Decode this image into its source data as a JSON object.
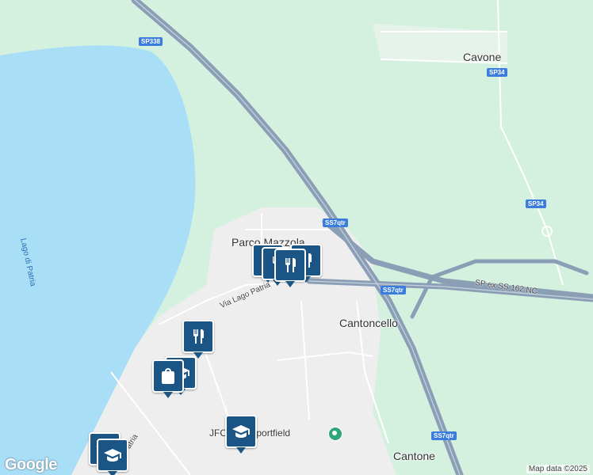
{
  "map": {
    "place_labels": {
      "cavone": "Cavone",
      "parco_mazzola": "Parco Mazzola",
      "cantoncello": "Cantoncello",
      "cantone": "Cantone"
    },
    "road_shields": {
      "sp338": "SP338",
      "sp34_north": "SP34",
      "sp34_east": "SP34",
      "ss7qtr_north": "SS7qtr",
      "ss7qtr_mid": "SS7qtr",
      "ss7qtr_south": "SS7qtr"
    },
    "road_labels": {
      "via_lago_patria": "Via Lago Patria",
      "sp_ex_ss162": "SP ex SS 162 NC",
      "lago_patria_bottom": "Lago Patria"
    },
    "lake_label": "Lago di Patria",
    "poi_labels": {
      "sportfield": "JFC      LES Sportfield"
    },
    "colors": {
      "water": "#a9def7",
      "land_green": "#d4f1e0",
      "urban": "#eeeeef",
      "highway": "#8a9fb5",
      "pin": "#1b5585",
      "sport": "#2fa779"
    },
    "pins": [
      {
        "type": "restaurant",
        "icon": "fork-knife-icon"
      },
      {
        "type": "restaurant",
        "icon": "fork-knife-icon"
      },
      {
        "type": "restaurant",
        "icon": "fork-knife-icon"
      },
      {
        "type": "restaurant",
        "icon": "fork-knife-icon"
      },
      {
        "type": "restaurant",
        "icon": "fork-knife-icon"
      },
      {
        "type": "school",
        "icon": "graduation-cap-icon"
      },
      {
        "type": "shopping",
        "icon": "shopping-bag-icon"
      },
      {
        "type": "school",
        "icon": "graduation-cap-icon"
      },
      {
        "type": "school",
        "icon": "graduation-cap-icon"
      }
    ],
    "logo": "Google",
    "attribution": "Map data ©2025"
  }
}
